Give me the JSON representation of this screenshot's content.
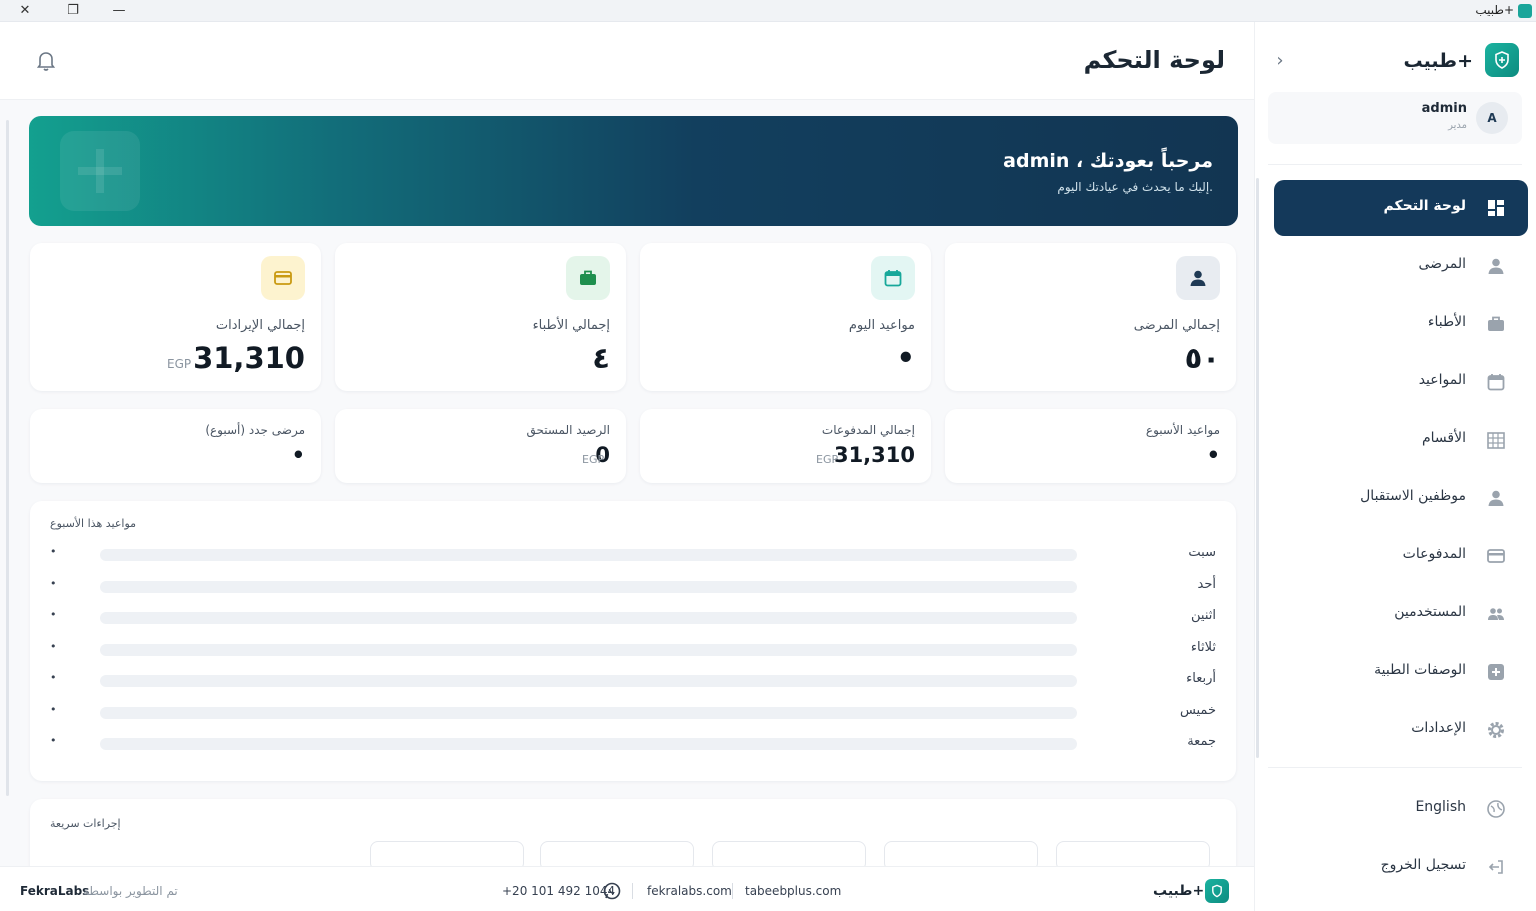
{
  "window": {
    "title": "طبيب+"
  },
  "brand": {
    "name": "طبيب+",
    "accent": "#14395a",
    "teal": "#16a394"
  },
  "user": {
    "initial": "A",
    "name": "admin",
    "role": "مدير"
  },
  "sidebar": {
    "items": [
      {
        "label": "لوحة التحكم",
        "icon": "dashboard-icon",
        "active": true
      },
      {
        "label": "المرضى",
        "icon": "person-icon"
      },
      {
        "label": "الأطباء",
        "icon": "briefcase-icon"
      },
      {
        "label": "المواعيد",
        "icon": "calendar-icon"
      },
      {
        "label": "الأقسام",
        "icon": "building-icon"
      },
      {
        "label": "موظفين الاستقبال",
        "icon": "person-icon"
      },
      {
        "label": "المدفوعات",
        "icon": "credit-card-icon"
      },
      {
        "label": "المستخدمين",
        "icon": "users-icon"
      },
      {
        "label": "الوصفات الطبية",
        "icon": "medical-plus-icon"
      },
      {
        "label": "الإعدادات",
        "icon": "gear-icon"
      }
    ],
    "language": "English",
    "logout": "تسجيل الخروج"
  },
  "header": {
    "title": "لوحة التحكم"
  },
  "banner": {
    "title_prefix": "مرحباً بعودتك ،",
    "title_name": "admin",
    "subtitle": "إليك ما يحدث في عيادتك اليوم."
  },
  "stats": [
    {
      "label": "إجمالي المرضى",
      "value": "٥٠",
      "icon": "person-icon",
      "color": "#1f3a55",
      "bg": "#e8ecf1"
    },
    {
      "label": "مواعيد اليوم",
      "value": "•",
      "icon": "calendar-icon",
      "color": "#17a89a",
      "bg": "#e3f6f3"
    },
    {
      "label": "إجمالي الأطباء",
      "value": "٤",
      "icon": "briefcase-icon",
      "color": "#1e8f4e",
      "bg": "#e4f5ea"
    },
    {
      "label": "إجمالي الإيرادات",
      "value": "31,310",
      "unit": "EGP",
      "icon": "credit-card-icon",
      "color": "#c99a12",
      "bg": "#fdf3cf"
    }
  ],
  "small_stats": [
    {
      "label": "مواعيد الأسبوع",
      "value": "•"
    },
    {
      "label": "إجمالي المدفوعات",
      "value": "31,310",
      "unit": "EGP"
    },
    {
      "label": "الرصيد المستحق",
      "value": "0",
      "unit": "EGP"
    },
    {
      "label": "مرضى جدد (أسبوع)",
      "value": "•"
    }
  ],
  "week": {
    "title": "مواعيد هذا الأسبوع",
    "days": [
      {
        "label": "سبت",
        "count": "•",
        "level": 0
      },
      {
        "label": "أحد",
        "count": "•",
        "level": 0
      },
      {
        "label": "اثنين",
        "count": "•",
        "level": 0
      },
      {
        "label": "ثلاثاء",
        "count": "•",
        "level": 0
      },
      {
        "label": "أربعاء",
        "count": "•",
        "level": 0
      },
      {
        "label": "خميس",
        "count": "•",
        "level": 0
      },
      {
        "label": "جمعة",
        "count": "•",
        "level": 0
      }
    ]
  },
  "quick_actions": {
    "title": "إجراءات سريعة"
  },
  "footer": {
    "dev_name": "FekraLabs",
    "dev_text": "تم التطوير بواسطة",
    "phone": "+20 101 492 1044",
    "site1": "fekralabs.com",
    "site2": "tabeebplus.com",
    "brand": "طبيب+"
  }
}
